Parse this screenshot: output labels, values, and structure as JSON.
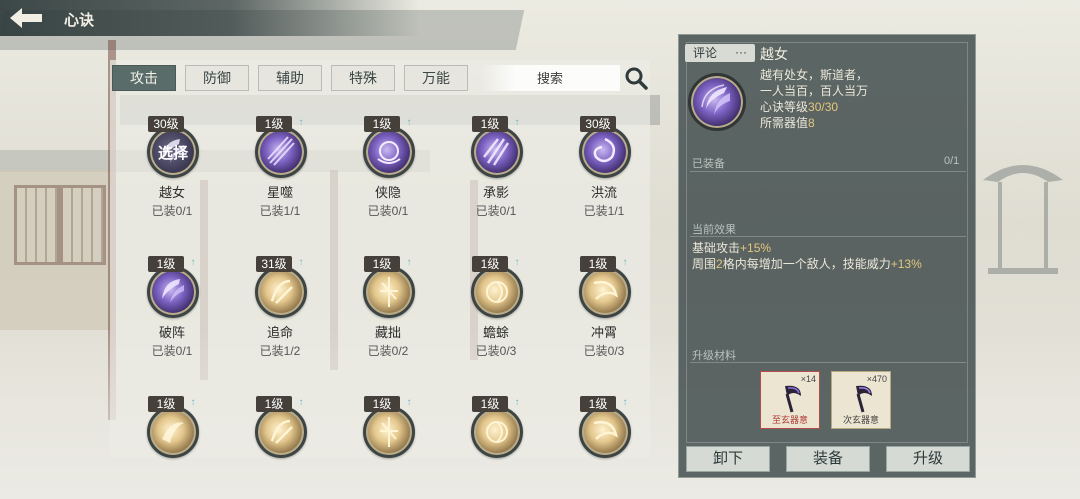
{
  "header": {
    "title": "心诀"
  },
  "tabs": [
    {
      "label": "攻击",
      "active": true
    },
    {
      "label": "防御"
    },
    {
      "label": "辅助"
    },
    {
      "label": "特殊"
    },
    {
      "label": "万能"
    }
  ],
  "search": {
    "placeholder": "搜索"
  },
  "skills": [
    {
      "level": "30级",
      "name": "越女",
      "equip": "已装0/1",
      "style": "dark",
      "overlay": "选择",
      "upgrade": false
    },
    {
      "level": "1级",
      "name": "星噬",
      "equip": "已装1/1",
      "style": "purple",
      "upgrade": true
    },
    {
      "level": "1级",
      "name": "侠隐",
      "equip": "已装0/1",
      "style": "purple",
      "upgrade": true
    },
    {
      "level": "1级",
      "name": "承影",
      "equip": "已装0/1",
      "style": "purple",
      "upgrade": true
    },
    {
      "level": "30级",
      "name": "洪流",
      "equip": "已装1/1",
      "style": "purple",
      "upgrade": false
    },
    {
      "level": "1级",
      "name": "破阵",
      "equip": "已装0/1",
      "style": "purple",
      "upgrade": true
    },
    {
      "level": "31级",
      "name": "追命",
      "equip": "已装1/2",
      "style": "gold",
      "upgrade": true
    },
    {
      "level": "1级",
      "name": "藏拙",
      "equip": "已装0/2",
      "style": "gold",
      "upgrade": true
    },
    {
      "level": "1级",
      "name": "蟾蜍",
      "equip": "已装0/3",
      "style": "gold",
      "upgrade": true
    },
    {
      "level": "1级",
      "name": "冲霄",
      "equip": "已装0/3",
      "style": "gold",
      "upgrade": true
    },
    {
      "level": "1级",
      "name": "",
      "equip": "",
      "style": "gold",
      "upgrade": true
    },
    {
      "level": "1级",
      "name": "",
      "equip": "",
      "style": "gold",
      "upgrade": true
    },
    {
      "level": "1级",
      "name": "",
      "equip": "",
      "style": "gold",
      "upgrade": true
    },
    {
      "level": "1级",
      "name": "",
      "equip": "",
      "style": "gold",
      "upgrade": true
    },
    {
      "level": "1级",
      "name": "",
      "equip": "",
      "style": "gold",
      "upgrade": true
    }
  ],
  "detail": {
    "comment_label": "评论",
    "comment_dots": "···",
    "title": "越女",
    "desc_line1": "越有处女，斯道者，",
    "desc_line2": "一人当百，百人当万",
    "level_label": "心诀等级",
    "level_value": "30/30",
    "req_label": "所需器值",
    "req_value": "8",
    "equipped_title": "已装备",
    "equipped_count": "0/1",
    "effect_title": "当前效果",
    "effect_line1_a": "基础攻击",
    "effect_line1_b": "+15%",
    "effect_line2_a": "周围",
    "effect_line2_b": "2",
    "effect_line2_c": "格内每增加一个敌人，技能威力",
    "effect_line2_d": "+13%",
    "materials_title": "升级材料",
    "materials": [
      {
        "name": "至玄器意",
        "count": "×14",
        "accent": "#b03a35"
      },
      {
        "name": "次玄器意",
        "count": "×470",
        "accent": "#444444"
      }
    ]
  },
  "actions": {
    "unequip": "卸下",
    "equip": "装备",
    "upgrade": "升级"
  },
  "colors": {
    "highlight": "#e3c77d",
    "panel": "#3c4848",
    "tab_active": "#5a6c6a"
  }
}
